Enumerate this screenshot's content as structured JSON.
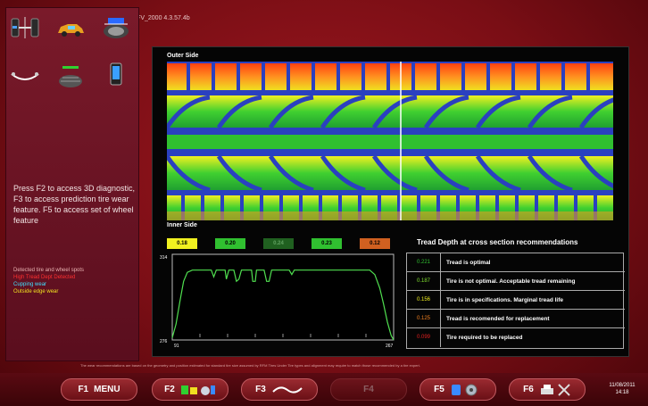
{
  "header": {
    "version": "RFV_2000   4.3.57.4b"
  },
  "sidebar": {
    "icons": [
      "vehicle-wheel-alignment-icon",
      "car-icon",
      "rfv-wheel-icon",
      "axle-bend-icon",
      "tire-tread-icon",
      "phone-icon"
    ],
    "help_text": "Press F2 to access 3D diagnostic, F3 to access prediction tire wear feature. F5 to access set of wheel feature",
    "legend": {
      "title": "Detected tire and wheel spots",
      "items": [
        {
          "label": "High Tread Dept Detected",
          "color": "#ff3030"
        },
        {
          "label": "Cupping wear",
          "color": "#40e0ff"
        },
        {
          "label": "Outside edge wear",
          "color": "#f0e020"
        }
      ]
    }
  },
  "main": {
    "outer_label": "Outer Side",
    "inner_label": "Inner Side",
    "depth_chips": [
      {
        "value": "0.18",
        "bg": "#f0f020",
        "fg": "#000000"
      },
      {
        "value": "0.20",
        "bg": "#30c030",
        "fg": "#000000"
      },
      {
        "value": "0.24",
        "bg": "#206020",
        "fg": "#60a060"
      },
      {
        "value": "0.23",
        "bg": "#30c030",
        "fg": "#000000"
      },
      {
        "value": "0.12",
        "bg": "#d06020",
        "fg": "#000000"
      }
    ],
    "chart_data": {
      "type": "line",
      "x_ticks": [
        "91",
        "267"
      ],
      "y_ticks": [
        "314",
        "276"
      ],
      "xlim": [
        91,
        267
      ],
      "ylim": [
        276,
        314
      ],
      "series": [
        {
          "color": "#50e050",
          "points": [
            [
              91,
              277
            ],
            [
              94,
              283
            ],
            [
              97,
              293
            ],
            [
              100,
              302
            ],
            [
              103,
              306
            ],
            [
              107,
              307
            ],
            [
              112,
              307
            ],
            [
              118,
              307
            ],
            [
              122,
              307
            ],
            [
              124,
              304
            ],
            [
              126,
              307
            ],
            [
              130,
              307
            ],
            [
              133,
              307
            ],
            [
              134,
              303
            ],
            [
              136,
              307
            ],
            [
              140,
              307
            ],
            [
              142,
              302
            ],
            [
              144,
              303
            ],
            [
              146,
              307
            ],
            [
              150,
              307
            ],
            [
              154,
              307
            ],
            [
              155,
              302
            ],
            [
              157,
              302
            ],
            [
              158,
              307
            ],
            [
              160,
              307
            ],
            [
              164,
              307
            ],
            [
              166,
              302
            ],
            [
              168,
              302
            ],
            [
              170,
              307
            ],
            [
              176,
              307
            ],
            [
              180,
              307
            ],
            [
              184,
              307
            ],
            [
              186,
              305
            ],
            [
              188,
              307
            ],
            [
              195,
              307
            ],
            [
              200,
              307
            ],
            [
              210,
              307
            ],
            [
              220,
              307
            ],
            [
              230,
              307
            ],
            [
              240,
              307
            ],
            [
              248,
              307
            ],
            [
              252,
              305
            ],
            [
              256,
              299
            ],
            [
              259,
              292
            ],
            [
              262,
              284
            ],
            [
              265,
              278
            ],
            [
              267,
              276
            ]
          ]
        }
      ]
    },
    "recommendations": {
      "title": "Tread Depth at cross section recommendations",
      "rows": [
        {
          "value": "0.221",
          "color": "#30c030",
          "text": "Tread is optimal"
        },
        {
          "value": "0.187",
          "color": "#80e030",
          "text": "Tire is not optimal. Acceptable tread remaining"
        },
        {
          "value": "0.156",
          "color": "#f0f020",
          "text": "Tire is in specifications. Marginal tread life"
        },
        {
          "value": "0.125",
          "color": "#f08020",
          "text": "Tread is recomended for replacement"
        },
        {
          "value": "0.099",
          "color": "#e02020",
          "text": "Tire required to be replaced"
        }
      ]
    }
  },
  "disclaimer": "The wear recommendations are based on the geometry and position estimated for standard tire size assumed by RFM Tires     Under Tire types and alignment may require to match those recommended by a tire expert.",
  "bottom_bar": {
    "f1": {
      "key": "F1",
      "label": "MENU"
    },
    "f2": {
      "key": "F2",
      "icon": "3d-diagnostic-icon"
    },
    "f3": {
      "key": "F3",
      "icon": "wear-prediction-icon"
    },
    "f4": {
      "key": "F4"
    },
    "f5": {
      "key": "F5",
      "icon": "wheel-set-icon"
    },
    "f6": {
      "key": "F6",
      "icon": "printer-tools-icon"
    },
    "date": "11/08/2011",
    "time": "14:18"
  }
}
